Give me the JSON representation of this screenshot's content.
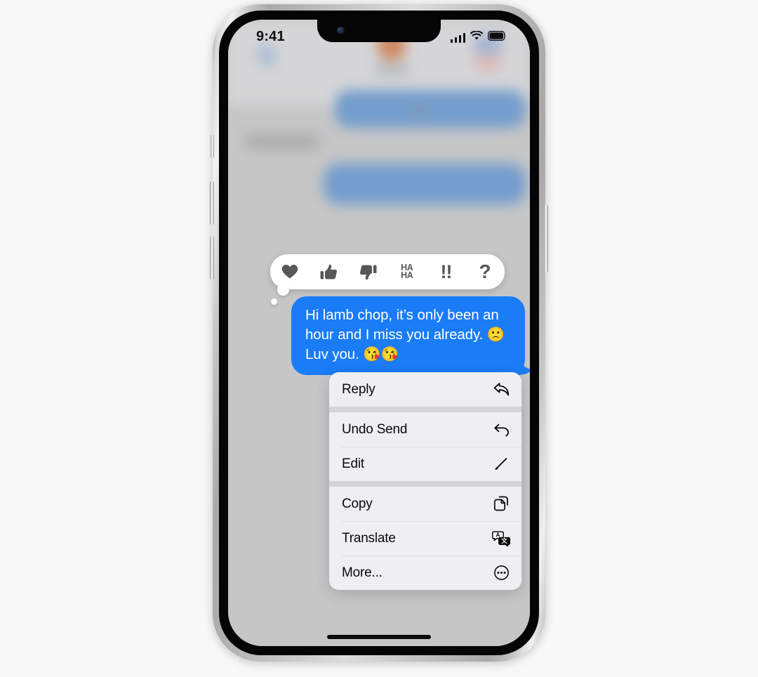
{
  "device": {
    "name": "iphone-13-pro",
    "frame_color": "#c9c9c9",
    "screen_bg": "#cbcbcb"
  },
  "status_bar": {
    "time": "9:41",
    "cellular_icon": "signal-bars-icon",
    "wifi_icon": "wifi-icon",
    "battery_icon": "battery-full-icon"
  },
  "background_conversation": {
    "blurred": true,
    "nav_avatar_color": "#d9611c",
    "bubble_color": "#3c85d8",
    "bubbles": 2,
    "timestamp_placeholder": true
  },
  "tapback_bar": {
    "name": "tapback-reaction-bar",
    "background": "#ffffff",
    "icon_color": "#585858",
    "reactions": [
      {
        "id": "heart",
        "icon": "heart-icon",
        "label": ""
      },
      {
        "id": "thumbsup",
        "icon": "thumbs-up-icon",
        "label": ""
      },
      {
        "id": "thumbsdown",
        "icon": "thumbs-down-icon",
        "label": ""
      },
      {
        "id": "haha",
        "icon": "haha-icon",
        "label": "HA HA"
      },
      {
        "id": "exclamation",
        "icon": "double-exclamation-icon",
        "label": "!!"
      },
      {
        "id": "question",
        "icon": "question-mark-icon",
        "label": "?"
      }
    ],
    "haha_line1": "HA",
    "haha_line2": "HA",
    "bang_label": "!!",
    "question_label": "?"
  },
  "message": {
    "sender": "me",
    "bubble_color": "#1a7cf7",
    "text_color": "#ffffff",
    "text": "Hi lamb chop, it’s only been an hour and I miss you already. 🙁 Luv you. 😘😘",
    "line1": "Hi lamb chop, it’s only been an",
    "line2": "hour and I miss you already. 🙁",
    "line3": "Luv you. 😘😘"
  },
  "context_menu": {
    "background": "#efeef2",
    "separator_color": "#d5d5d9",
    "groups": [
      {
        "items": [
          {
            "label": "Reply",
            "icon": "reply-arrow-icon"
          }
        ]
      },
      {
        "items": [
          {
            "label": "Undo Send",
            "icon": "undo-arrow-icon"
          },
          {
            "label": "Edit",
            "icon": "pencil-icon"
          }
        ]
      },
      {
        "items": [
          {
            "label": "Copy",
            "icon": "copy-documents-icon"
          },
          {
            "label": "Translate",
            "icon": "translate-bubbles-icon"
          },
          {
            "label": "More...",
            "icon": "ellipsis-circle-icon"
          }
        ]
      }
    ]
  },
  "home_indicator": {
    "visible": true
  }
}
